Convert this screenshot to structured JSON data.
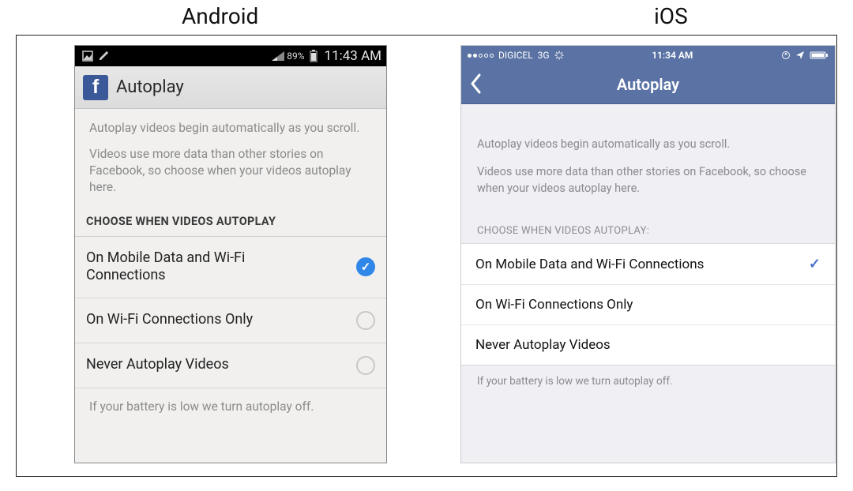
{
  "labels": {
    "android": "Android",
    "ios": "iOS"
  },
  "android": {
    "status": {
      "battery_pct": "89%",
      "time": "11:43 AM"
    },
    "title": "Autoplay",
    "desc1": "Autoplay videos begin automatically as you scroll.",
    "desc2": "Videos use more data than other stories on Facebook, so choose when your videos autoplay here.",
    "section": "CHOOSE WHEN VIDEOS AUTOPLAY",
    "options": {
      "opt1": "On Mobile Data and Wi-Fi Connections",
      "opt2": "On Wi-Fi Connections Only",
      "opt3": "Never Autoplay Videos"
    },
    "footer": "If your battery is low we turn autoplay off."
  },
  "ios": {
    "status": {
      "carrier": "DIGICEL",
      "network": "3G",
      "time": "11:34 AM"
    },
    "title": "Autoplay",
    "desc1": "Autoplay videos begin automatically as you scroll.",
    "desc2": "Videos use more data than other stories on Facebook, so choose when your videos autoplay here.",
    "section": "CHOOSE WHEN VIDEOS AUTOPLAY:",
    "options": {
      "opt1": "On Mobile Data and Wi-Fi Connections",
      "opt2": "On Wi-Fi Connections Only",
      "opt3": "Never Autoplay Videos"
    },
    "footer": "If your battery is low we turn autoplay off."
  }
}
